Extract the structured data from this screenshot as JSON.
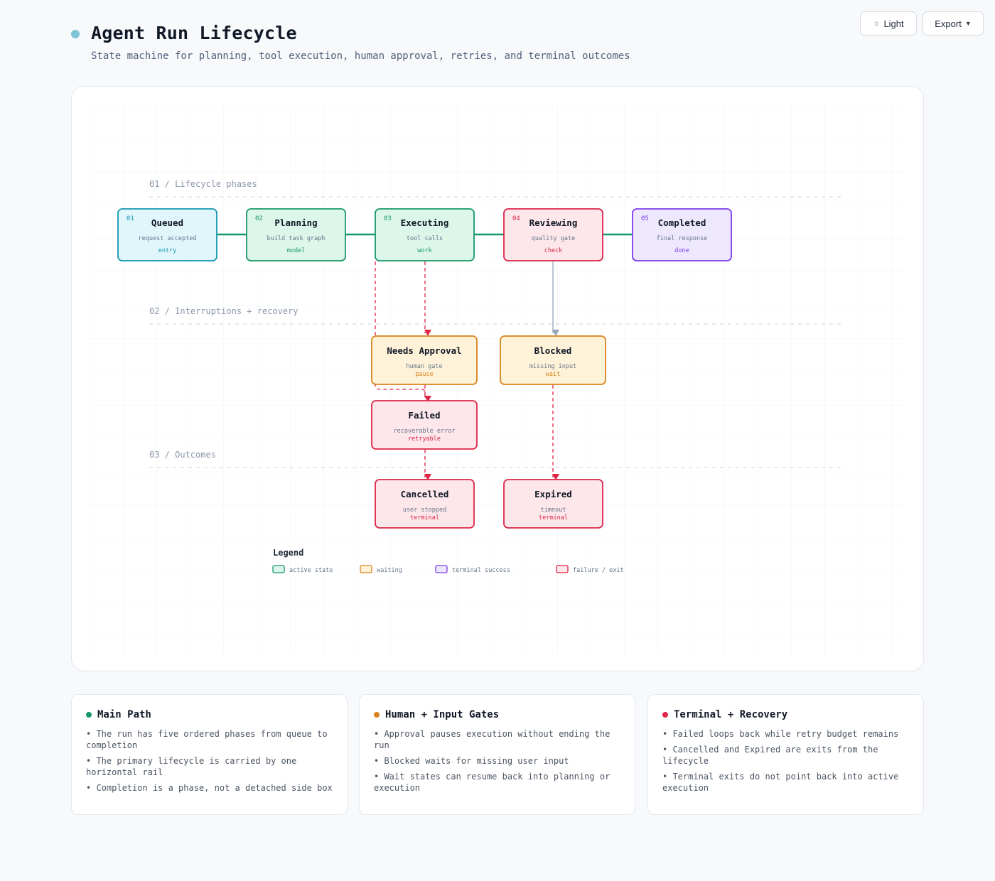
{
  "header": {
    "title": "Agent Run Lifecycle",
    "subtitle": "State machine for planning, tool execution, human approval, retries, and terminal outcomes"
  },
  "toolbar": {
    "theme_icon": "sun-icon",
    "theme_label": "Light",
    "export_label": "Export",
    "export_icon": "chevron-down-icon"
  },
  "colors": {
    "accent_dot": "#7ec3d6",
    "active": "#16966b",
    "entry": "#1596b0",
    "waiting": "#d9821c",
    "failure": "#dc2547",
    "success": "#7c3aed",
    "neutral_arrow": "#94a3b8"
  },
  "diagram": {
    "sections": [
      "01 / Lifecycle phases",
      "02 / Interruptions + recovery",
      "03 / Outcomes"
    ],
    "phases": [
      {
        "id": "queued",
        "num": "01",
        "title": "Queued",
        "desc": "request accepted",
        "tag": "entry",
        "kind": "entry"
      },
      {
        "id": "planning",
        "num": "02",
        "title": "Planning",
        "desc": "build task graph",
        "tag": "model",
        "kind": "active"
      },
      {
        "id": "executing",
        "num": "03",
        "title": "Executing",
        "desc": "tool calls",
        "tag": "work",
        "kind": "active"
      },
      {
        "id": "reviewing",
        "num": "04",
        "title": "Reviewing",
        "desc": "quality gate",
        "tag": "check",
        "kind": "failure"
      },
      {
        "id": "completed",
        "num": "05",
        "title": "Completed",
        "desc": "final response",
        "tag": "done",
        "kind": "success"
      }
    ],
    "states": [
      {
        "id": "needs-approval",
        "title": "Needs Approval",
        "desc": "human gate",
        "tag": "pause",
        "kind": "waiting"
      },
      {
        "id": "blocked",
        "title": "Blocked",
        "desc": "missing input",
        "tag": "wait",
        "kind": "waiting"
      },
      {
        "id": "failed",
        "title": "Failed",
        "desc": "recoverable error",
        "tag": "retryable",
        "kind": "failure"
      },
      {
        "id": "cancelled",
        "title": "Cancelled",
        "desc": "user stopped",
        "tag": "terminal",
        "kind": "failure"
      },
      {
        "id": "expired",
        "title": "Expired",
        "desc": "timeout",
        "tag": "terminal",
        "kind": "failure"
      }
    ],
    "legend": {
      "title": "Legend",
      "items": [
        {
          "label": "active state",
          "kind": "active"
        },
        {
          "label": "waiting",
          "kind": "waiting"
        },
        {
          "label": "terminal success",
          "kind": "success"
        },
        {
          "label": "failure / exit",
          "kind": "failure"
        }
      ]
    }
  },
  "cards": [
    {
      "title": "Main Path",
      "dot_color": "#16966b",
      "items": [
        "• The run has five ordered phases from queue to completion",
        "• The primary lifecycle is carried by one horizontal rail",
        "• Completion is a phase, not a detached side box"
      ]
    },
    {
      "title": "Human + Input Gates",
      "dot_color": "#d9821c",
      "items": [
        "• Approval pauses execution without ending the run",
        "• Blocked waits for missing user input",
        "• Wait states can resume back into planning or execution"
      ]
    },
    {
      "title": "Terminal + Recovery",
      "dot_color": "#dc2547",
      "items": [
        "• Failed loops back while retry budget remains",
        "• Cancelled and Expired are exits from the lifecycle",
        "• Terminal exits do not point back into active execution"
      ]
    }
  ]
}
